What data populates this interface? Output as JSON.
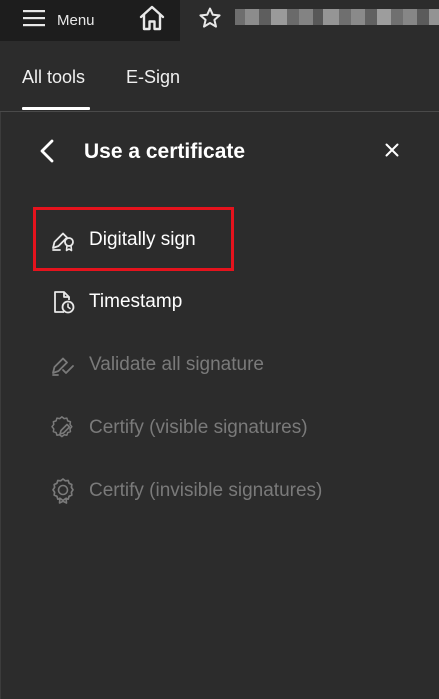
{
  "topbar": {
    "menu_label": "Menu",
    "icons": [
      "hamburger-icon",
      "home-icon",
      "star-icon"
    ]
  },
  "tabs": [
    {
      "label": "All tools",
      "active": true
    },
    {
      "label": "E-Sign",
      "active": false
    }
  ],
  "panel": {
    "title": "Use a certificate",
    "back_icon": "chevron-left-icon",
    "close_icon": "close-icon",
    "items": [
      {
        "label": "Digitally sign",
        "icon": "digital-sign-icon",
        "enabled": true,
        "highlighted": true
      },
      {
        "label": "Timestamp",
        "icon": "timestamp-icon",
        "enabled": true,
        "highlighted": false
      },
      {
        "label": "Validate all signature",
        "icon": "validate-signature-icon",
        "enabled": false,
        "highlighted": false
      },
      {
        "label": "Certify (visible signatures)",
        "icon": "certify-visible-icon",
        "enabled": false,
        "highlighted": false
      },
      {
        "label": "Certify (invisible signatures)",
        "icon": "certify-invisible-icon",
        "enabled": false,
        "highlighted": false
      }
    ]
  },
  "colors": {
    "topbar_bg": "#1d1d1d",
    "panel_bg": "#2c2c2c",
    "highlight": "#e5131d",
    "disabled_text": "#7a7a7a"
  }
}
